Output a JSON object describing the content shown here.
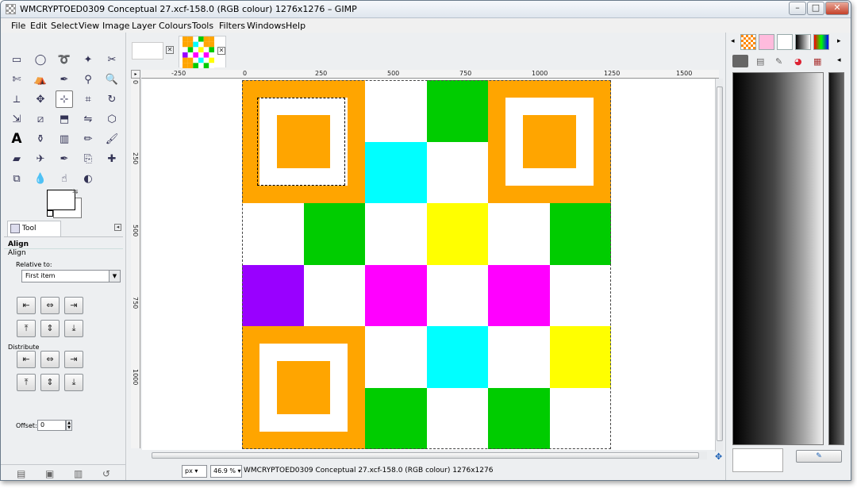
{
  "window": {
    "title": "WMCRYPTOED0309 Conceptual 27.xcf-158.0 (RGB colour) 1276x1276 – GIMP",
    "controls": [
      "–",
      "□",
      "✕"
    ]
  },
  "menubar": [
    "File",
    "Edit",
    "Select",
    "View",
    "Image",
    "Layer",
    "Colours",
    "Tools",
    "Filters",
    "Windows",
    "Help"
  ],
  "toolbox": {
    "tools": [
      "rect-select",
      "ellipse-select",
      "free-select",
      "fuzzy-select",
      "select-by-color",
      "scissors-select",
      "foreground-select",
      "paths",
      "color-picker",
      "zoom",
      "measure",
      "move",
      "align",
      "crop",
      "rotate",
      "scale",
      "shear",
      "perspective",
      "flip",
      "cage",
      "text",
      "bucket-fill",
      "blend",
      "pencil",
      "paintbrush",
      "eraser",
      "airbrush",
      "ink",
      "clone",
      "heal",
      "perspective-clone",
      "blur",
      "smudge",
      "dodge-burn"
    ],
    "active_tool": "align"
  },
  "tool_options": {
    "tab_label": "Tool Options",
    "section_title": "Align",
    "subtitle": "Align",
    "relative_to_label": "Relative to:",
    "relative_to_value": "First item",
    "distribute_label": "Distribute",
    "offset_label": "Offset:",
    "offset_value": "0"
  },
  "image_tabs": [
    {
      "name": "blank-image"
    },
    {
      "name": "qr-image",
      "active": true
    }
  ],
  "ruler": {
    "h_labels": [
      "-250",
      "0",
      "250",
      "500",
      "750",
      "1000",
      "1250",
      "1500"
    ],
    "v_labels": [
      "0",
      "250",
      "500",
      "750",
      "1000"
    ]
  },
  "canvas": {
    "grid": [
      [
        "orange",
        "orange",
        "white",
        "green",
        "orange",
        "orange"
      ],
      [
        "orange",
        "orange",
        "cyan",
        "white",
        "orange",
        "orange"
      ],
      [
        "white",
        "green",
        "white",
        "yellow",
        "white",
        "green"
      ],
      [
        "purple",
        "white",
        "magenta",
        "white",
        "magenta",
        "white"
      ],
      [
        "orange",
        "orange",
        "white",
        "cyan",
        "white",
        "yellow"
      ],
      [
        "orange",
        "orange",
        "green",
        "white",
        "green",
        "white"
      ]
    ],
    "colors": {
      "orange": "#ffa500",
      "white": "#ffffff",
      "green": "#00cc00",
      "cyan": "#00ffff",
      "yellow": "#ffff00",
      "purple": "#9900ff",
      "magenta": "#ff00ff"
    }
  },
  "statusbar": {
    "unit": "px",
    "zoom": "46.9 %",
    "text": "WMCRYPTOED0309 Conceptual 27.xcf-158.0 (RGB colour) 1276x1276"
  }
}
